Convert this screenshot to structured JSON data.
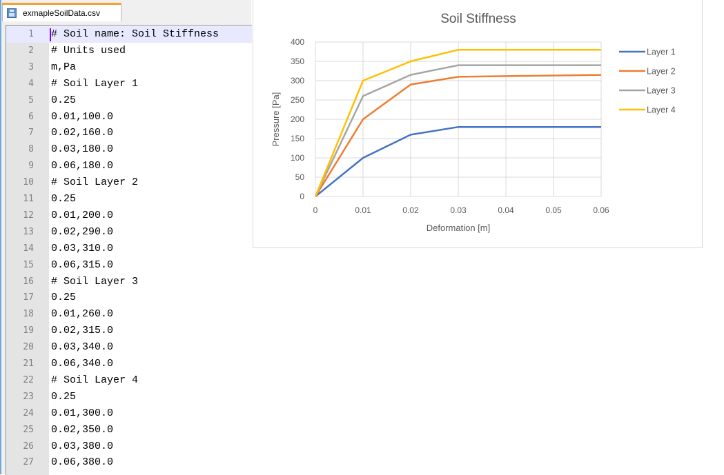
{
  "editor": {
    "tab_title": "exmapleSoilData.csv",
    "tab_icon": "save-file-icon",
    "active_line": 1,
    "lines": [
      "# Soil name: Soil Stiffness",
      "# Units used",
      "m,Pa",
      "# Soil Layer 1",
      "0.25",
      "0.01,100.0",
      "0.02,160.0",
      "0.03,180.0",
      "0.06,180.0",
      "# Soil Layer 2",
      "0.25",
      "0.01,200.0",
      "0.02,290.0",
      "0.03,310.0",
      "0.06,315.0",
      "# Soil Layer 3",
      "0.25",
      "0.01,260.0",
      "0.02,315.0",
      "0.03,340.0",
      "0.06,340.0",
      "# Soil Layer 4",
      "0.25",
      "0.01,300.0",
      "0.02,350.0",
      "0.03,380.0",
      "0.06,380.0"
    ]
  },
  "chart_data": {
    "type": "line",
    "title": "Soil Stiffness",
    "xlabel": "Deformation [m]",
    "ylabel": "Pressure [Pa]",
    "xlim": [
      0,
      0.06
    ],
    "ylim": [
      0,
      400
    ],
    "xticks": [
      "0",
      "0.01",
      "0.02",
      "0.03",
      "0.04",
      "0.05",
      "0.06"
    ],
    "yticks": [
      "0",
      "50",
      "100",
      "150",
      "200",
      "250",
      "300",
      "350",
      "400"
    ],
    "grid": true,
    "legend_position": "right",
    "series": [
      {
        "name": "Layer 1",
        "color": "#4472c4",
        "x": [
          0,
          0.01,
          0.02,
          0.03,
          0.06
        ],
        "y": [
          0,
          100,
          160,
          180,
          180
        ]
      },
      {
        "name": "Layer 2",
        "color": "#ed7d31",
        "x": [
          0,
          0.01,
          0.02,
          0.03,
          0.06
        ],
        "y": [
          0,
          200,
          290,
          310,
          315
        ]
      },
      {
        "name": "Layer 3",
        "color": "#a5a5a5",
        "x": [
          0,
          0.01,
          0.02,
          0.03,
          0.06
        ],
        "y": [
          0,
          260,
          315,
          340,
          340
        ]
      },
      {
        "name": "Layer 4",
        "color": "#ffc000",
        "x": [
          0,
          0.01,
          0.02,
          0.03,
          0.06
        ],
        "y": [
          0,
          300,
          350,
          380,
          380
        ]
      }
    ]
  }
}
